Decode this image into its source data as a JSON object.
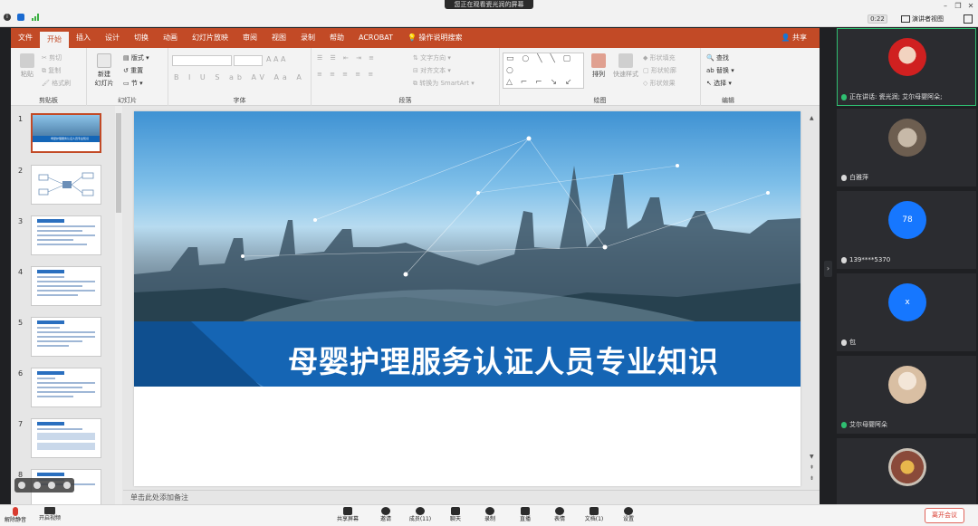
{
  "share_banner": "您正在观看瓷光润的屏幕",
  "meeting": {
    "timer": "0:22",
    "view_mode": "演讲者视图"
  },
  "ppt": {
    "tabs": [
      "文件",
      "开始",
      "插入",
      "设计",
      "切换",
      "动画",
      "幻灯片放映",
      "审阅",
      "视图",
      "录制",
      "帮助",
      "ACROBAT"
    ],
    "active_tab": "开始",
    "search": "操作说明搜索",
    "share": "共享",
    "ribbon": {
      "paste": "粘贴",
      "cut": "剪切",
      "copy": "复制",
      "format_painter": "格式刷",
      "clipboard": "剪贴板",
      "new_slide": "新建",
      "new_slide_2": "幻灯片",
      "layout": "版式",
      "reset": "重置",
      "section": "节",
      "slides": "幻灯片",
      "font": "字体",
      "text_direction": "文字方向",
      "align_text": "对齐文本",
      "smartart": "转换为 SmartArt",
      "paragraph": "段落",
      "arrange": "排列",
      "quick_styles": "快速样式",
      "shape_fill": "形状填充",
      "shape_outline": "形状轮廓",
      "shape_effects": "形状效果",
      "drawing": "绘图",
      "find": "查找",
      "replace": "替换",
      "select": "选择",
      "editing": "编辑"
    },
    "slide_numbers": [
      "1",
      "2",
      "3",
      "4",
      "5",
      "6",
      "7",
      "8"
    ],
    "slide_title": "母婴护理服务认证人员专业知识",
    "thumb1_title": "母婴护理服务认证人员专业知识",
    "notes_placeholder": "单击此处添加备注"
  },
  "participants": [
    {
      "name": "正在讲话: 瓷光润; 艾尔母婴阿朵;",
      "avatar": "photo",
      "speaking": true
    },
    {
      "name": "白雅萍",
      "avatar": "photo"
    },
    {
      "name": "139****5370",
      "avatar": "78"
    },
    {
      "name": "包",
      "avatar": "x"
    },
    {
      "name": "艾尔母婴阿朵",
      "avatar": "photo"
    },
    {
      "name": "",
      "avatar": "photo"
    }
  ],
  "toolbar": {
    "unmute": "解除静音",
    "start_video": "开启视频",
    "share_screen": "共享屏幕",
    "invite": "邀请",
    "members": "成员(11)",
    "chat": "聊天",
    "record": "录制",
    "live": "直播",
    "reactions": "表情",
    "docs": "文档(1)",
    "settings": "设置",
    "leave": "离开会议"
  },
  "colors": {
    "ppt_accent": "#c24a26",
    "slide_band": "#1565b4",
    "active_speaker": "#2fbf71",
    "leave": "#d83b2f"
  }
}
